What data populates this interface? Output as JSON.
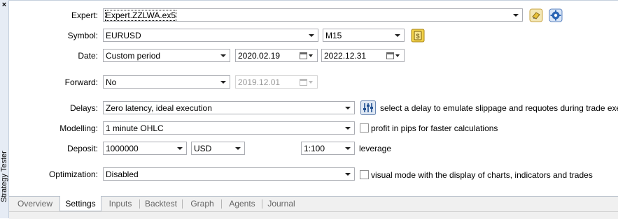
{
  "panel": {
    "title": "Strategy Tester",
    "close_glyph": "×"
  },
  "labels": {
    "expert": "Expert:",
    "symbol": "Symbol:",
    "date": "Date:",
    "forward": "Forward:",
    "delays": "Delays:",
    "modelling": "Modelling:",
    "deposit": "Deposit:",
    "optimization": "Optimization:"
  },
  "expert": {
    "value": "Expert.ZZLWA.ex5"
  },
  "symbol": {
    "value": "EURUSD",
    "timeframe": "M15"
  },
  "date": {
    "period": "Custom period",
    "from": "2020.02.19",
    "to": "2022.12.31"
  },
  "forward": {
    "value": "No",
    "date": "2019.12.01"
  },
  "delays": {
    "value": "Zero latency, ideal execution",
    "hint": "select a delay to emulate slippage and requotes during trade execution"
  },
  "modelling": {
    "value": "1 minute OHLC",
    "option_label": "profit in pips for faster calculations",
    "option_checked": false
  },
  "deposit": {
    "amount": "1000000",
    "currency": "USD",
    "leverage": "1:100",
    "leverage_label": "leverage"
  },
  "optimization": {
    "value": "Disabled",
    "option_label": "visual mode with the display of charts, indicators and trades",
    "option_checked": false
  },
  "tabs": [
    {
      "label": "Overview",
      "active": false
    },
    {
      "label": "Settings",
      "active": true
    },
    {
      "label": "Inputs",
      "active": false
    },
    {
      "label": "Backtest",
      "active": false
    },
    {
      "label": "Graph",
      "active": false
    },
    {
      "label": "Agents",
      "active": false
    },
    {
      "label": "Journal",
      "active": false
    }
  ],
  "colors": {
    "accent_blue": "#2a64b4",
    "gold": "#e8c23a",
    "panel_bg": "#e6ecf5"
  }
}
